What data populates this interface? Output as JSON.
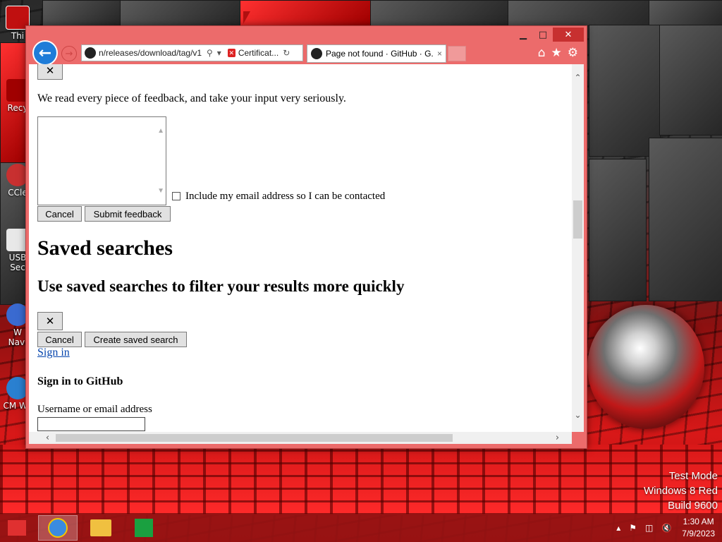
{
  "desktop": {
    "icons": [
      {
        "label": "Thi",
        "name": "desktop-icon-this-pc",
        "color": "#c01010"
      },
      {
        "label": "Recy",
        "name": "desktop-icon-recycle-bin",
        "color": "#a00000"
      },
      {
        "label": "CCle",
        "name": "desktop-icon-ccleaner",
        "color": "#c83030"
      },
      {
        "label": "USB Sec",
        "name": "desktop-icon-usb-security",
        "color": "#e8e8e8"
      },
      {
        "label": "W Navi",
        "name": "desktop-icon-navigator",
        "color": "#3a6ad0"
      },
      {
        "label": "CM We",
        "name": "desktop-icon-cm-web",
        "color": "#2a80d0"
      }
    ],
    "watermark": {
      "line1": "Test Mode",
      "line2": "Windows 8 Red",
      "line3": "Build 9600"
    }
  },
  "browser": {
    "address": {
      "url": "n/releases/download/tag/v1",
      "search_icon": "search-icon",
      "cert_label": "Certificat...",
      "refresh_icon": "refresh-icon"
    },
    "tab": {
      "title": "Page not found · GitHub · G...",
      "close": "×"
    },
    "window_controls": {
      "minimize": "▁",
      "maximize": "□",
      "close": "✕"
    },
    "tools": {
      "home": "⌂",
      "favorites": "★",
      "settings": "⚙"
    }
  },
  "page": {
    "close_x": "✕",
    "feedback_text": "We read every piece of feedback, and take your input very seriously.",
    "include_email_label": "Include my email address so I can be contacted",
    "cancel_label": "Cancel",
    "submit_feedback_label": "Submit feedback",
    "saved_searches_heading": "Saved searches",
    "saved_searches_subheading": "Use saved searches to filter your results more quickly",
    "dialog_close_x": "✕",
    "cancel2_label": "Cancel",
    "create_saved_search_label": "Create saved search",
    "sign_in_link": "Sign in",
    "sign_in_heading": "Sign in to GitHub",
    "username_label": "Username or email address"
  },
  "taskbar": {
    "clock_time": "1:30 AM",
    "clock_date": "7/9/2023",
    "accent": "#961414"
  }
}
